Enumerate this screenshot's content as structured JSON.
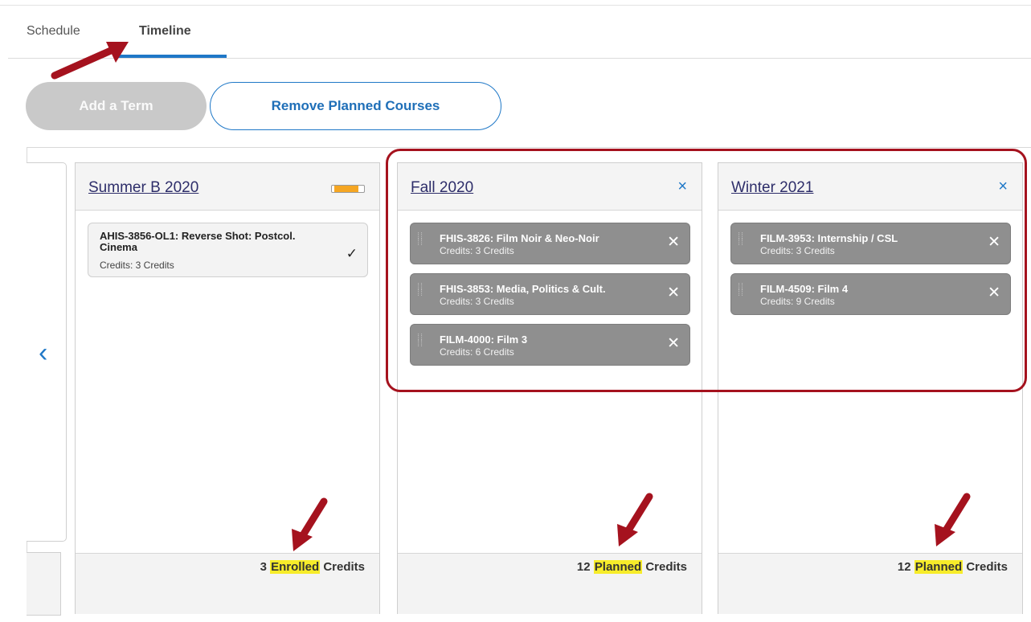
{
  "tabs": {
    "schedule": "Schedule",
    "timeline": "Timeline"
  },
  "buttons": {
    "add_term": "Add a Term",
    "remove_planned": "Remove Planned Courses"
  },
  "terms": [
    {
      "title": "Summer B 2020",
      "courses": [
        {
          "title": "AHIS-3856-OL1: Reverse Shot: Postcol. Cinema",
          "credits": "Credits: 3 Credits"
        }
      ],
      "credits_count": "3",
      "credits_status": "Enrolled",
      "credits_suffix": "Credits"
    },
    {
      "title": "Fall 2020",
      "close": "×",
      "courses": [
        {
          "title": "FHIS-3826: Film Noir & Neo-Noir",
          "credits": "Credits: 3 Credits"
        },
        {
          "title": "FHIS-3853: Media, Politics & Cult.",
          "credits": "Credits: 3 Credits"
        },
        {
          "title": "FILM-4000: Film 3",
          "credits": "Credits: 6 Credits"
        }
      ],
      "credits_count": "12",
      "credits_status": "Planned",
      "credits_suffix": "Credits"
    },
    {
      "title": "Winter 2021",
      "close": "×",
      "courses": [
        {
          "title": "FILM-3953: Internship / CSL",
          "credits": "Credits: 3 Credits"
        },
        {
          "title": "FILM-4509: Film 4",
          "credits": "Credits: 9 Credits"
        }
      ],
      "credits_count": "12",
      "credits_status": "Planned",
      "credits_suffix": "Credits"
    }
  ],
  "icons": {
    "prev": "‹",
    "check": "✓",
    "remove": "✕",
    "grip": "⋮⋮"
  },
  "colors": {
    "accent": "#1f78c7",
    "annotation": "#a5121e",
    "highlight": "#f7ec2a",
    "planned_course": "#8f8f8f"
  }
}
